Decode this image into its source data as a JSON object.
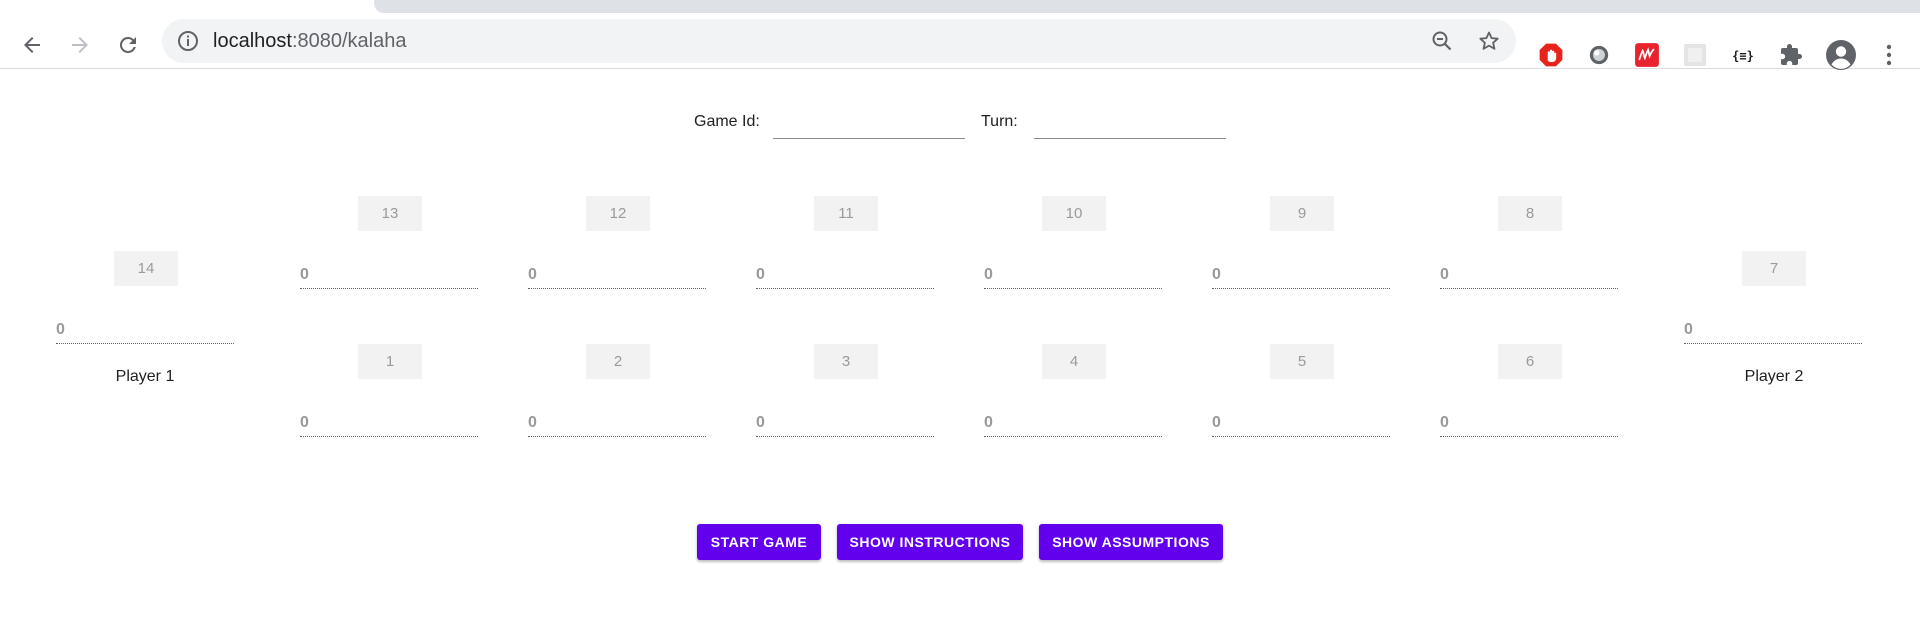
{
  "browser": {
    "url_host": "localhost",
    "url_path": ":8080/kalaha",
    "icons": [
      "back-arrow-icon",
      "forward-arrow-icon",
      "reload-icon",
      "info-icon",
      "zoom-out-icon",
      "bookmark-star-icon",
      "adblock-icon",
      "extension-grey-icon",
      "myntra-icon",
      "extension-blank-icon",
      "json-formatter-icon",
      "puzzle-icon",
      "profile-avatar-icon",
      "kebab-menu-icon"
    ]
  },
  "game": {
    "game_id_label": "Game Id:",
    "game_id_value": "",
    "turn_label": "Turn:",
    "turn_value": ""
  },
  "board": {
    "top_pits": [
      {
        "number": "13",
        "seeds": "0"
      },
      {
        "number": "12",
        "seeds": "0"
      },
      {
        "number": "11",
        "seeds": "0"
      },
      {
        "number": "10",
        "seeds": "0"
      },
      {
        "number": "9",
        "seeds": "0"
      },
      {
        "number": "8",
        "seeds": "0"
      }
    ],
    "bottom_pits": [
      {
        "number": "1",
        "seeds": "0"
      },
      {
        "number": "2",
        "seeds": "0"
      },
      {
        "number": "3",
        "seeds": "0"
      },
      {
        "number": "4",
        "seeds": "0"
      },
      {
        "number": "5",
        "seeds": "0"
      },
      {
        "number": "6",
        "seeds": "0"
      }
    ],
    "left_store": {
      "number": "14",
      "seeds": "0",
      "player": "Player 1"
    },
    "right_store": {
      "number": "7",
      "seeds": "0",
      "player": "Player 2"
    }
  },
  "actions": {
    "start": "START GAME",
    "instructions": "SHOW INSTRUCTIONS",
    "assumptions": "SHOW ASSUMPTIONS"
  },
  "colors": {
    "accent": "#6200ee",
    "pit_bg": "#f2f2f2",
    "muted_text": "#9a9a9a"
  }
}
